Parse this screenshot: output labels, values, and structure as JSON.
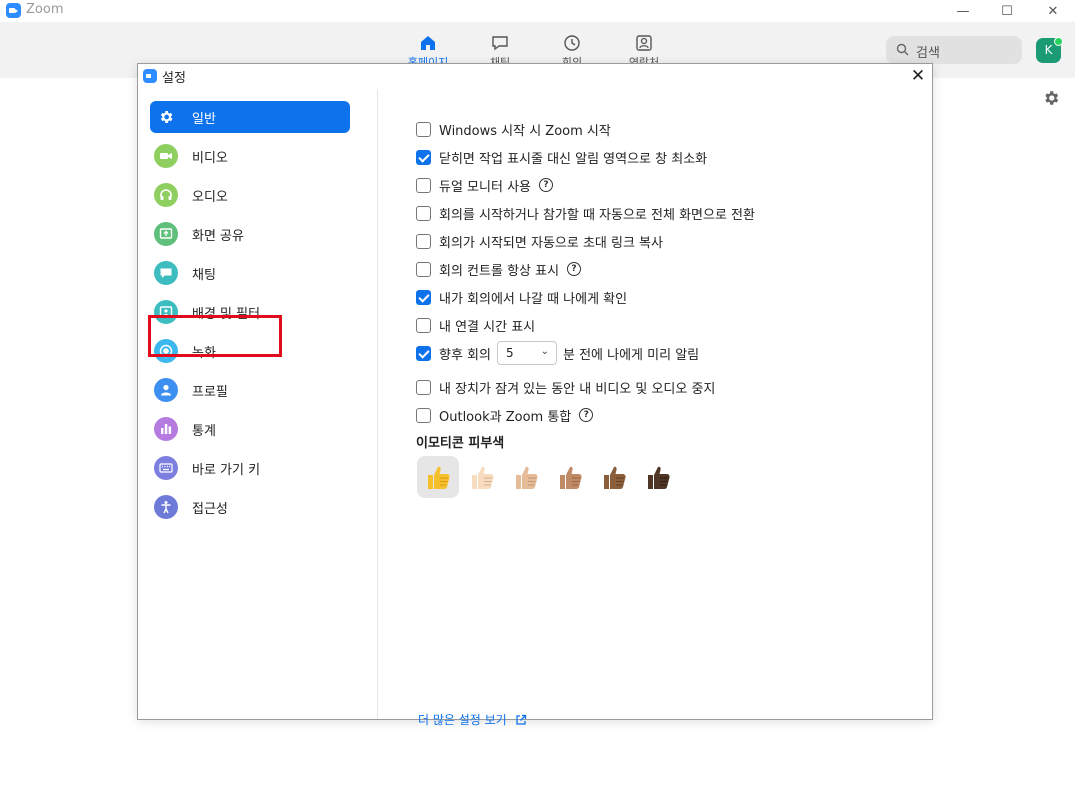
{
  "app": {
    "title": "Zoom"
  },
  "window_controls": {
    "minimize": "—",
    "maximize": "☐",
    "close": "✕"
  },
  "topnav": {
    "items": [
      {
        "label": "홈페이지",
        "icon": "home-icon",
        "active": true
      },
      {
        "label": "채팅",
        "icon": "chat-icon",
        "active": false
      },
      {
        "label": "회의",
        "icon": "clock-icon",
        "active": false
      },
      {
        "label": "연락처",
        "icon": "contacts-icon",
        "active": false
      }
    ],
    "search_placeholder": "검색",
    "avatar_initial": "K"
  },
  "dialog": {
    "title": "설정",
    "close": "✕",
    "sidebar": [
      {
        "label": "일반",
        "icon": "gear-icon",
        "active": true
      },
      {
        "label": "비디오",
        "icon": "video-icon",
        "color": "#8ecf5f"
      },
      {
        "label": "오디오",
        "icon": "headphones-icon",
        "color": "#8ecf5f"
      },
      {
        "label": "화면 공유",
        "icon": "share-screen-icon",
        "color": "#5ec07a"
      },
      {
        "label": "채팅",
        "icon": "chat-bubble-icon",
        "color": "#3dbdc0"
      },
      {
        "label": "배경 및 필터",
        "icon": "background-icon",
        "color": "#3dbdc0",
        "highlighted": true
      },
      {
        "label": "녹화",
        "icon": "record-icon",
        "color": "#3db8ee"
      },
      {
        "label": "프로필",
        "icon": "profile-icon",
        "color": "#3d8ff0"
      },
      {
        "label": "통계",
        "icon": "stats-icon",
        "color": "#b57be0"
      },
      {
        "label": "바로 가기 키",
        "icon": "keyboard-icon",
        "color": "#7c7ee0"
      },
      {
        "label": "접근성",
        "icon": "accessibility-icon",
        "color": "#6d7ad8"
      }
    ],
    "general": {
      "options": [
        {
          "label": "Windows 시작 시 Zoom 시작",
          "checked": false,
          "help": false
        },
        {
          "label": "닫히면 작업 표시줄 대신 알림 영역으로 창 최소화",
          "checked": true,
          "help": false
        },
        {
          "label": "듀얼 모니터 사용",
          "checked": false,
          "help": true
        },
        {
          "label": "회의를 시작하거나 참가할 때 자동으로 전체 화면으로 전환",
          "checked": false,
          "help": false
        },
        {
          "label": "회의가 시작되면 자동으로 초대 링크 복사",
          "checked": false,
          "help": false
        },
        {
          "label": "회의 컨트롤 항상 표시",
          "checked": false,
          "help": true
        },
        {
          "label": "내가 회의에서 나갈 때 나에게 확인",
          "checked": true,
          "help": false
        },
        {
          "label": "내 연결 시간 표시",
          "checked": false,
          "help": false
        }
      ],
      "reminder": {
        "prefix": "향후 회의",
        "value": "5",
        "suffix": "분 전에 나에게 미리 알림",
        "checked": true
      },
      "options2": [
        {
          "label": "내 장치가 잠겨 있는 동안 내 비디오 및 오디오 중지",
          "checked": false,
          "help": false
        },
        {
          "label": "Outlook과 Zoom 통합",
          "checked": false,
          "help": true
        }
      ],
      "emoji_heading": "이모티콘 피부색",
      "skin_tones": [
        {
          "name": "thumbs-up-default",
          "color": "#f6c02c",
          "selected": true
        },
        {
          "name": "thumbs-up-light",
          "color": "#f7dcc0"
        },
        {
          "name": "thumbs-up-medium-light",
          "color": "#e6bb98"
        },
        {
          "name": "thumbs-up-medium",
          "color": "#c08a66"
        },
        {
          "name": "thumbs-up-medium-dark",
          "color": "#8b5e3c"
        },
        {
          "name": "thumbs-up-dark",
          "color": "#4e3526"
        }
      ],
      "more_settings": "더 많은 설정 보기"
    }
  },
  "colors": {
    "accent": "#0e72ed",
    "highlight": "#e00b1c"
  }
}
